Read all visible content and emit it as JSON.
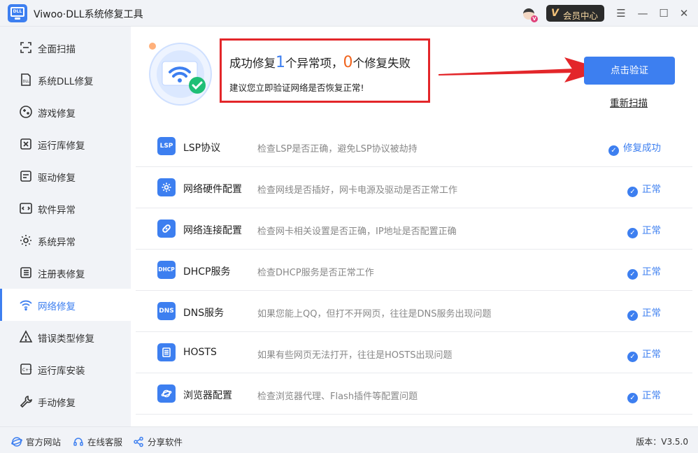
{
  "app": {
    "title": "Viwoo·DLL系统修复工具",
    "logo_text": "DLL"
  },
  "titlebar": {
    "vip_label": "会员中心",
    "vip_glyph": "V",
    "avatar_badge": "V"
  },
  "sidebar": {
    "items": [
      {
        "label": "全面扫描",
        "icon": "scan-icon"
      },
      {
        "label": "系统DLL修复",
        "icon": "dll-file-icon"
      },
      {
        "label": "游戏修复",
        "icon": "gamepad-icon"
      },
      {
        "label": "运行库修复",
        "icon": "vs-runtime-icon"
      },
      {
        "label": "驱动修复",
        "icon": "driver-icon"
      },
      {
        "label": "软件异常",
        "icon": "code-window-icon"
      },
      {
        "label": "系统异常",
        "icon": "gear-icon"
      },
      {
        "label": "注册表修复",
        "icon": "list-icon"
      },
      {
        "label": "网络修复",
        "icon": "wifi-icon",
        "active": true
      },
      {
        "label": "错误类型修复",
        "icon": "warning-icon"
      },
      {
        "label": "运行库安装",
        "icon": "cplusplus-icon"
      },
      {
        "label": "手动修复",
        "icon": "wrench-icon"
      }
    ]
  },
  "result": {
    "prefix": "成功修复",
    "fixed_count": "1",
    "middle": "个异常项，",
    "failed_count": "0",
    "suffix": "个修复失败",
    "subtitle": "建议您立即验证网络是否恢复正常!"
  },
  "actions": {
    "verify": "点击验证",
    "rescan": "重新扫描"
  },
  "checks": [
    {
      "name": "LSP协议",
      "desc": "检查LSP是否正确，避免LSP协议被劫持",
      "status": "修复成功",
      "icon_text": "LSP"
    },
    {
      "name": "网络硬件配置",
      "desc": "检查网线是否插好，网卡电源及驱动是否正常工作",
      "status": "正常",
      "icon_text": ""
    },
    {
      "name": "网络连接配置",
      "desc": "检查网卡相关设置是否正确，IP地址是否配置正确",
      "status": "正常",
      "icon_text": ""
    },
    {
      "name": "DHCP服务",
      "desc": "检查DHCP服务是否正常工作",
      "status": "正常",
      "icon_text": "DHCP"
    },
    {
      "name": "DNS服务",
      "desc": "如果您能上QQ，但打不开网页，往往是DNS服务出现问题",
      "status": "正常",
      "icon_text": "DNS"
    },
    {
      "name": "HOSTS",
      "desc": "如果有些网页无法打开，往往是HOSTS出现问题",
      "status": "正常",
      "icon_text": ""
    },
    {
      "name": "浏览器配置",
      "desc": "检查浏览器代理、Flash插件等配置问题",
      "status": "正常",
      "icon_text": ""
    }
  ],
  "footer": {
    "website": "官方网站",
    "support": "在线客服",
    "share": "分享软件",
    "version": "版本：V3.5.0"
  },
  "colors": {
    "accent": "#3d7ff0",
    "highlight_border": "#e3262a",
    "failed": "#f0641e"
  }
}
